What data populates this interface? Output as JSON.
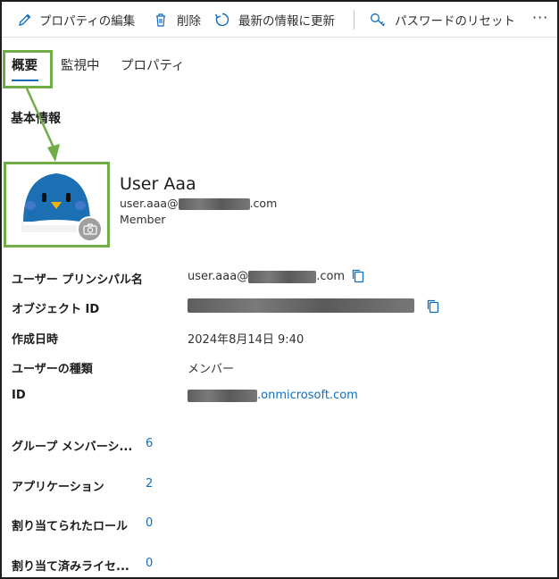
{
  "toolbar": {
    "edit_label": "プロパティの編集",
    "delete_label": "削除",
    "refresh_label": "最新の情報に更新",
    "reset_password_label": "パスワードのリセット",
    "more_label": "···"
  },
  "tabs": [
    {
      "label": "概要",
      "active": true
    },
    {
      "label": "監視中",
      "active": false
    },
    {
      "label": "プロパティ",
      "active": false
    }
  ],
  "section_title": "基本情報",
  "user": {
    "name": "User Aaa",
    "email_prefix": "user.aaa@",
    "email_suffix": ".com",
    "role": "Member"
  },
  "properties": {
    "upn_label": "ユーザー プリンシパル名",
    "upn_prefix": "user.aaa@",
    "upn_suffix": ".com",
    "object_id_label": "オブジェクト ID",
    "created_label": "作成日時",
    "created_value": "2024年8月14日 9:40",
    "user_type_label": "ユーザーの種類",
    "user_type_value": "メンバー",
    "id_label": "ID",
    "id_suffix": ".onmicrosoft.com"
  },
  "counts": [
    {
      "label": "グループ メンバーシ...",
      "value": "6"
    },
    {
      "label": "アプリケーション",
      "value": "2"
    },
    {
      "label": "割り当てられたロール",
      "value": "0"
    },
    {
      "label": "割り当て済みライセ...",
      "value": "0"
    }
  ],
  "colors": {
    "highlight": "#70ad47",
    "accent": "#0f6cbd",
    "avatar_blue": "#1d6fb4"
  },
  "icons": [
    "pencil-icon",
    "trash-icon",
    "refresh-icon",
    "key-icon",
    "camera-icon",
    "copy-icon"
  ]
}
